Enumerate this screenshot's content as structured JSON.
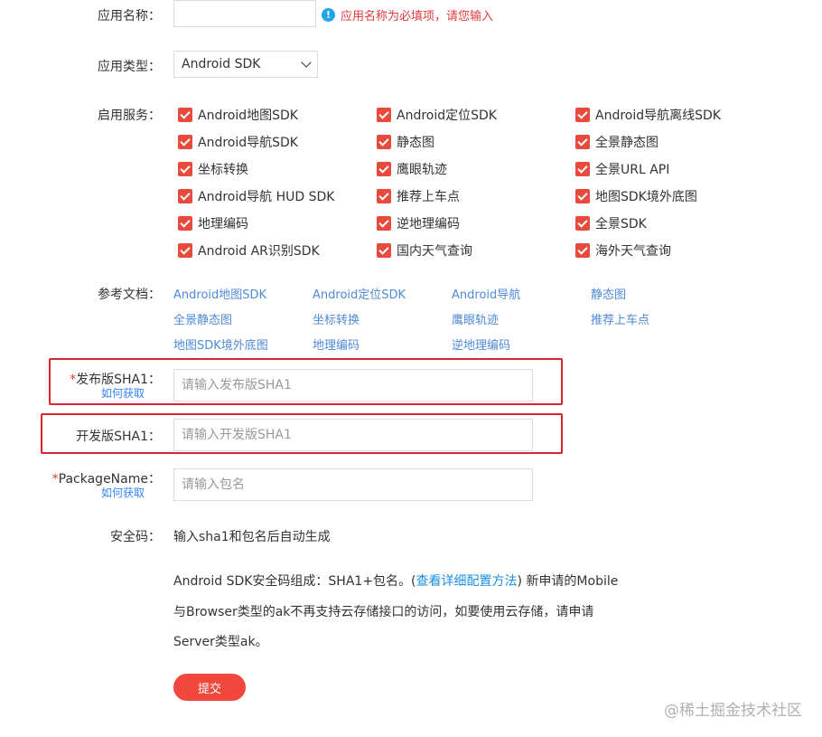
{
  "form": {
    "app_name": {
      "label": "应用名称：",
      "value": "",
      "placeholder": "",
      "error": "应用名称为必填项，请您输入",
      "error_icon": "!"
    },
    "app_type": {
      "label": "应用类型：",
      "selected": "Android SDK"
    },
    "services": {
      "label": "启用服务：",
      "col1": [
        "Android地图SDK",
        "Android导航SDK",
        "坐标转换",
        "Android导航 HUD SDK",
        "地理编码",
        "Android AR识别SDK"
      ],
      "col2": [
        "Android定位SDK",
        "静态图",
        "鹰眼轨迹",
        "推荐上车点",
        "逆地理编码",
        "国内天气查询"
      ],
      "col3": [
        "Android导航离线SDK",
        "全景静态图",
        "全景URL API",
        "地图SDK境外底图",
        "全景SDK",
        "海外天气查询"
      ]
    },
    "docs": {
      "label": "参考文档：",
      "row1": [
        "Android地图SDK",
        "Android定位SDK",
        "Android导航",
        "静态图"
      ],
      "row2": [
        "全景静态图",
        "坐标转换",
        "鹰眼轨迹",
        "推荐上车点"
      ],
      "row3": [
        "地图SDK境外底图",
        "地理编码",
        "逆地理编码"
      ]
    },
    "release_sha1": {
      "required": "*",
      "label": "发布版SHA1：",
      "howto": "如何获取",
      "placeholder": "请输入发布版SHA1",
      "value": ""
    },
    "dev_sha1": {
      "label": "开发版SHA1：",
      "placeholder": "请输入开发版SHA1",
      "value": ""
    },
    "package_name": {
      "required": "*",
      "label": "PackageName：",
      "howto": "如何获取",
      "placeholder": "请输入包名",
      "value": ""
    },
    "security_code": {
      "label": "安全码：",
      "value": "输入sha1和包名后自动生成"
    },
    "note": {
      "line1_prefix": "Android SDK安全码组成：SHA1+包名。(",
      "link": "查看详细配置方法",
      "line1_suffix": ") 新申请的Mobile",
      "line2": "与Browser类型的ak不再支持云存储接口的访问，如要使用云存储，请申请",
      "line3": "Server类型ak。"
    },
    "submit": "提交"
  },
  "watermark": "@稀土掘金技术社区",
  "colors": {
    "accent": "#f2473c",
    "checkbox": "#e84a3b",
    "link": "#4e8ad6",
    "error": "#e4393c",
    "highlight_box": "#d9262c"
  }
}
